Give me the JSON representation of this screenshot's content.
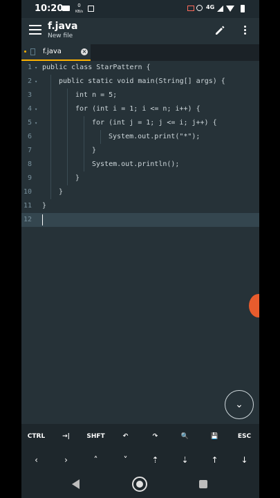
{
  "status_bar": {
    "time": "10:20",
    "net_speed_value": "0",
    "net_speed_unit": "KB/s",
    "network_label": "4G",
    "icons": [
      "video-camera-icon",
      "data-speed-icon",
      "calendar-icon",
      "cast-icon",
      "alarm-icon",
      "signal-icon",
      "wifi-icon",
      "battery-icon"
    ]
  },
  "app_bar": {
    "title": "f.java",
    "subtitle": "New file",
    "menu_icon": "hamburger-menu-icon",
    "edit_icon": "pencil-icon",
    "more_icon": "more-vert-icon"
  },
  "tab": {
    "label": "f.java",
    "modified": true
  },
  "editor": {
    "current_line": 12,
    "lines": [
      {
        "num": "1",
        "indent": 0,
        "fold": true,
        "text": "public class StarPattern {"
      },
      {
        "num": "2",
        "indent": 1,
        "fold": true,
        "text": "public static void main(String[] args) {"
      },
      {
        "num": "3",
        "indent": 2,
        "fold": false,
        "text": "int n = 5;"
      },
      {
        "num": "4",
        "indent": 2,
        "fold": true,
        "text": "for (int i = 1; i <= n; i++) {"
      },
      {
        "num": "5",
        "indent": 3,
        "fold": true,
        "text": "for (int j = 1; j <= i; j++) {"
      },
      {
        "num": "6",
        "indent": 4,
        "fold": false,
        "text": "System.out.print(\"*\");"
      },
      {
        "num": "7",
        "indent": 3,
        "fold": false,
        "text": "}"
      },
      {
        "num": "8",
        "indent": 3,
        "fold": false,
        "text": "System.out.println();"
      },
      {
        "num": "9",
        "indent": 2,
        "fold": false,
        "text": "}"
      },
      {
        "num": "10",
        "indent": 1,
        "fold": false,
        "text": "}"
      },
      {
        "num": "11",
        "indent": 0,
        "fold": false,
        "text": "}"
      },
      {
        "num": "12",
        "indent": 0,
        "fold": false,
        "text": ""
      }
    ]
  },
  "toolbar": {
    "keys": [
      {
        "label": "CTRL",
        "name": "ctrl-key"
      },
      {
        "label": "→|",
        "name": "tab-key"
      },
      {
        "label": "SHFT",
        "name": "shift-key"
      },
      {
        "label": "↶",
        "name": "undo-icon"
      },
      {
        "label": "↷",
        "name": "redo-icon"
      },
      {
        "label": "🔍",
        "name": "search-icon"
      },
      {
        "label": "💾",
        "name": "save-icon"
      },
      {
        "label": "ESC",
        "name": "esc-key"
      }
    ],
    "arrows": [
      {
        "label": "‹",
        "name": "arrow-left-icon"
      },
      {
        "label": "›",
        "name": "arrow-right-icon"
      },
      {
        "label": "˄",
        "name": "arrow-up-icon"
      },
      {
        "label": "˅",
        "name": "arrow-down-icon"
      },
      {
        "label": "⇡",
        "name": "page-up-icon"
      },
      {
        "label": "⇣",
        "name": "page-down-icon"
      },
      {
        "label": "↑",
        "name": "document-start-icon"
      },
      {
        "label": "↓",
        "name": "document-end-icon"
      }
    ]
  },
  "fab": {
    "icon": "chevron-down-icon",
    "symbol": "⌄"
  },
  "nav_bar": {
    "icons": [
      "nav-back-icon",
      "nav-home-icon",
      "nav-recents-icon"
    ]
  }
}
